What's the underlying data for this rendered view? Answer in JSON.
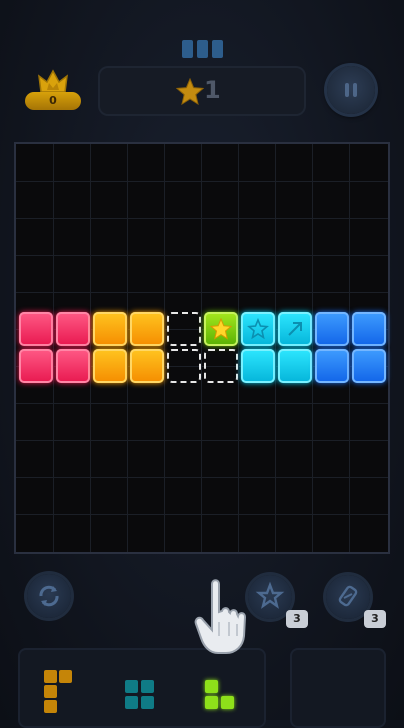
{
  "header": {
    "best_score": "0",
    "score": "1"
  },
  "board": {
    "rows": 11,
    "cols": 10,
    "row_top": [
      "red",
      "red",
      "orange",
      "orange",
      "empty",
      "green-star",
      "cyan-star",
      "cyan-arrow",
      "blue",
      "blue"
    ],
    "row_bottom": [
      "red",
      "red",
      "orange",
      "orange",
      "empty",
      "empty",
      "cyan",
      "cyan",
      "blue",
      "blue"
    ]
  },
  "tools": {
    "bomb_count": "3",
    "hammer_count": "3"
  },
  "colors": {
    "red": "#e8184f",
    "orange": "#f59b00",
    "cyan": "#05c8ec",
    "blue": "#1a6ff0",
    "green": "#6cc00a"
  },
  "icons": {
    "crown": "crown-icon",
    "star": "star-icon",
    "pause": "pause-icon",
    "refresh": "refresh-icon",
    "bomb": "bomb-icon",
    "hammer": "hammer-icon",
    "hand": "hand-pointer-icon"
  }
}
